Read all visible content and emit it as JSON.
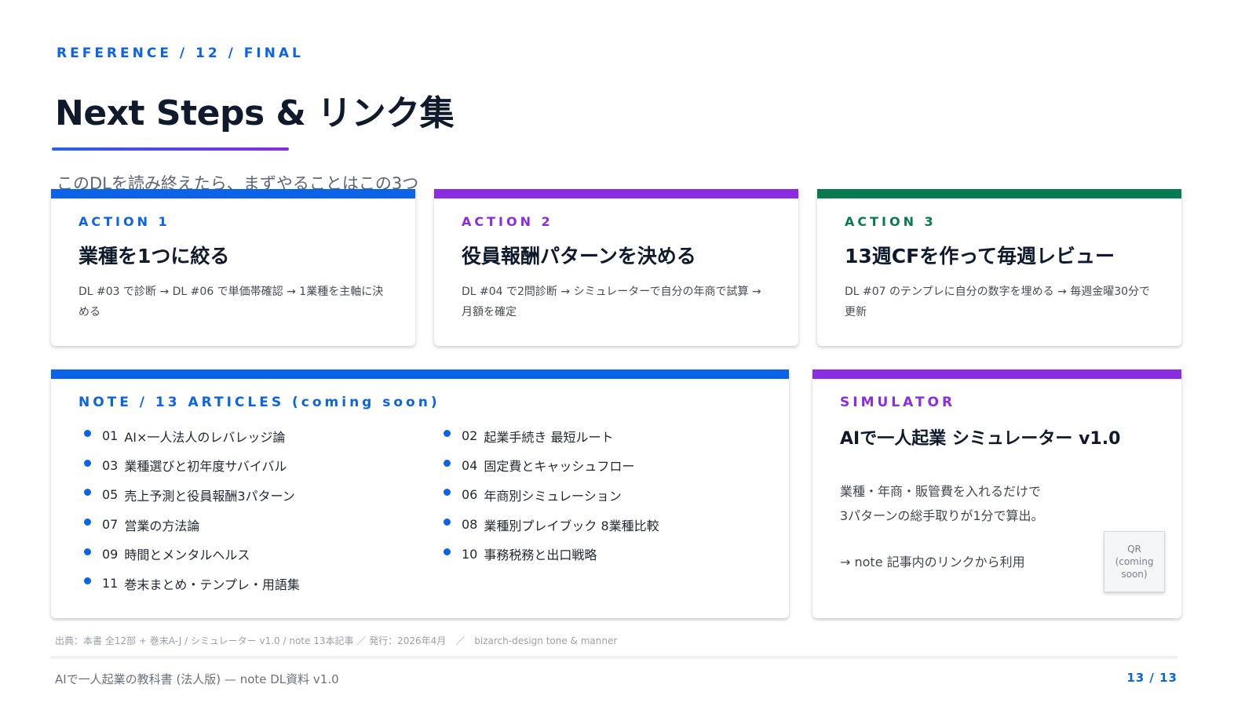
{
  "header": {
    "eyebrow": "REFERENCE / 12 / FINAL",
    "title": "Next Steps & リンク集",
    "subtitle": "このDLを読み終えたら、まずやることはこの3つ"
  },
  "actions": [
    {
      "label": "ACTION 1",
      "title": "業種を1つに絞る",
      "body": "DL #03 で診断 → DL #06 で単価帯確認 → 1業種を主軸に決める",
      "color": "#0a63e8"
    },
    {
      "label": "ACTION 2",
      "title": "役員報酬パターンを決める",
      "body": "DL #04 で2問診断 → シミュレーターで自分の年商で試算 → 月額を確定",
      "color": "#8b2be2"
    },
    {
      "label": "ACTION 3",
      "title": "13週CFを作って毎週レビュー",
      "body": "DL #07 のテンプレに自分の数字を埋める → 毎週金曜30分で更新",
      "color": "#087a52"
    }
  ],
  "note": {
    "label": "NOTE / 13 ARTICLES (coming soon)",
    "articles": [
      {
        "num": "01",
        "title": "AI×一人法人のレバレッジ論"
      },
      {
        "num": "02",
        "title": "起業手続き 最短ルート"
      },
      {
        "num": "03",
        "title": "業種選びと初年度サバイバル"
      },
      {
        "num": "04",
        "title": "固定費とキャッシュフロー"
      },
      {
        "num": "05",
        "title": "売上予測と役員報酬3パターン"
      },
      {
        "num": "06",
        "title": "年商別シミュレーション"
      },
      {
        "num": "07",
        "title": "営業の方法論"
      },
      {
        "num": "08",
        "title": "業種別プレイブック 8業種比較"
      },
      {
        "num": "09",
        "title": "時間とメンタルヘルス"
      },
      {
        "num": "10",
        "title": "事務税務と出口戦略"
      },
      {
        "num": "11",
        "title": "巻末まとめ・テンプレ・用語集"
      }
    ]
  },
  "simulator": {
    "label": "SIMULATOR",
    "title": "AIで一人起業 シミュレーター v1.0",
    "desc_line1": "業種・年商・販管費を入れるだけで",
    "desc_line2": "3パターンの総手取りが1分で算出。",
    "link": "→ note 記事内のリンクから利用",
    "qr_line1": "QR",
    "qr_line2": "(coming",
    "qr_line3": "soon)"
  },
  "source": "出典：本書 全12部 + 巻末A-J / シミュレーター v1.0 / note 13本記事 ／ 発行：2026年4月　／　bizarch-design tone & manner",
  "footer": {
    "left": "AIで一人起業の教科書 (法人版) — note DL資料 v1.0",
    "right": "13 / 13"
  },
  "colors": {
    "blue": "#0a63e8",
    "purple": "#8b2be2",
    "green": "#087a52"
  }
}
